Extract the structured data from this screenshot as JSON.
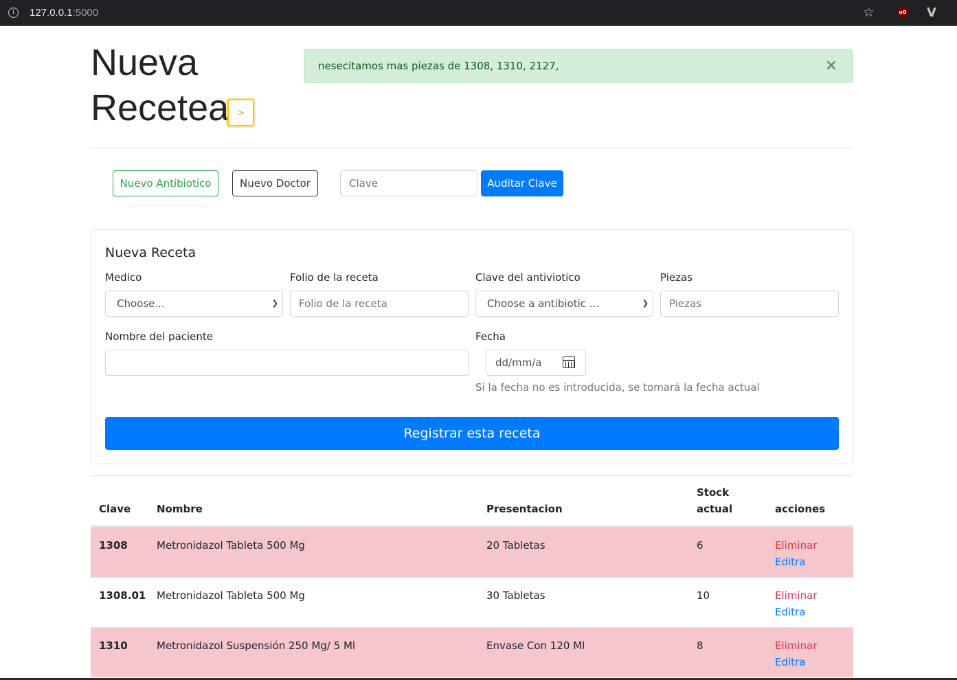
{
  "browser": {
    "url_host": "127.0.0.1",
    "url_port": ":5000",
    "info_icon": "info-icon",
    "star_icon": "star-icon"
  },
  "header": {
    "title_line1": "Nueva",
    "title_line2": "Recetea",
    "arrow_label": ">"
  },
  "alert": {
    "message": "nesecitamos mas piezas de 1308, 1310, 2127,",
    "close": "×"
  },
  "actions": {
    "nuevo_antibiotico": "Nuevo Antibiotico",
    "nuevo_doctor": "Nuevo Doctor",
    "clave_placeholder": "Clave",
    "auditar_clave": "Auditar Clave"
  },
  "form": {
    "title": "Nueva Receta",
    "medico_label": "Medico",
    "medico_value": "Choose...",
    "folio_label": "Folio de la receta",
    "folio_placeholder": "Folio de la receta",
    "clave_label": "Clave del antiviotico",
    "clave_value": "Choose a antibiotic ...",
    "piezas_label": "Piezas",
    "piezas_placeholder": "Piezas",
    "paciente_label": "Nombre del paciente",
    "fecha_label": "Fecha",
    "fecha_value": "dd/mm/a",
    "fecha_help": "Si la fecha no es introducida, se tomará la fecha actual",
    "submit": "Registrar esta receta"
  },
  "table": {
    "headers": {
      "clave": "Clave",
      "nombre": "Nombre",
      "presentacion": "Presentacion",
      "stock_1": "Stock",
      "stock_2": "actual",
      "acciones": "acciones"
    },
    "rows": [
      {
        "clave": "1308",
        "nombre": "Metronidazol Tableta 500 Mg",
        "presentacion": "20 Tabletas",
        "stock": "6",
        "eliminar": "Eliminar",
        "editar": "Editra",
        "low_stock": true
      },
      {
        "clave": "1308.01",
        "nombre": "Metronidazol Tableta 500 Mg",
        "presentacion": "30 Tabletas",
        "stock": "10",
        "eliminar": "Eliminar",
        "editar": "Editra",
        "low_stock": false
      },
      {
        "clave": "1310",
        "nombre": "Metronidazol Suspensión 250 Mg/ 5 Ml",
        "presentacion": "Envase Con 120 Ml",
        "stock": "8",
        "eliminar": "Eliminar",
        "editar": "Editra",
        "low_stock": true
      }
    ]
  },
  "colors": {
    "primary": "#007bff",
    "success": "#28a745",
    "danger": "#dc3545",
    "warning": "#ffc107",
    "row_danger_bg": "#f5c6cb",
    "alert_bg": "#d4edda"
  }
}
